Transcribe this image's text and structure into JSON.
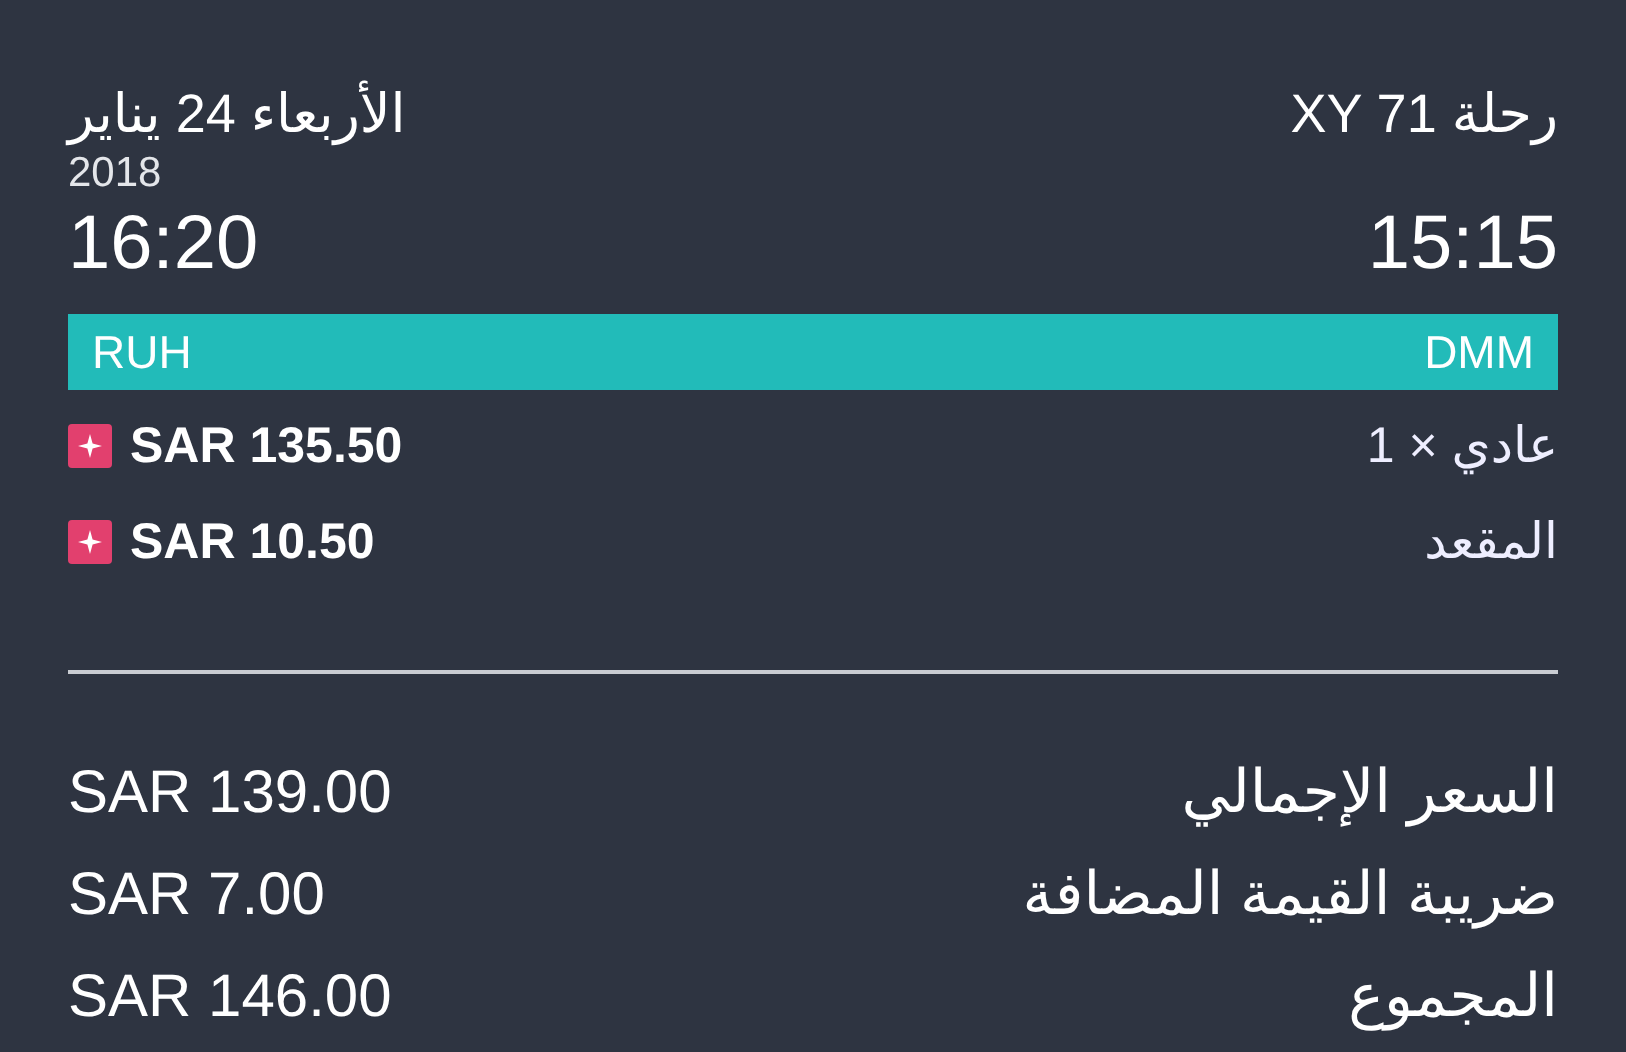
{
  "flight": {
    "number": "رحلة XY 71",
    "date": "الأربعاء 24 يناير",
    "year": "2018",
    "departure_time": "15:15",
    "arrival_time": "16:20"
  },
  "route": {
    "origin": "DMM",
    "destination": "RUH"
  },
  "fare_items": [
    {
      "label": "عادي × 1",
      "price": "SAR 135.50"
    },
    {
      "label": "المقعد",
      "price": "SAR 10.50"
    }
  ],
  "totals": [
    {
      "label": "السعر الإجمالي",
      "amount": "SAR 139.00"
    },
    {
      "label": "ضريبة القيمة المضافة",
      "amount": "SAR 7.00"
    },
    {
      "label": "المجموع",
      "amount": "SAR 146.00"
    }
  ]
}
